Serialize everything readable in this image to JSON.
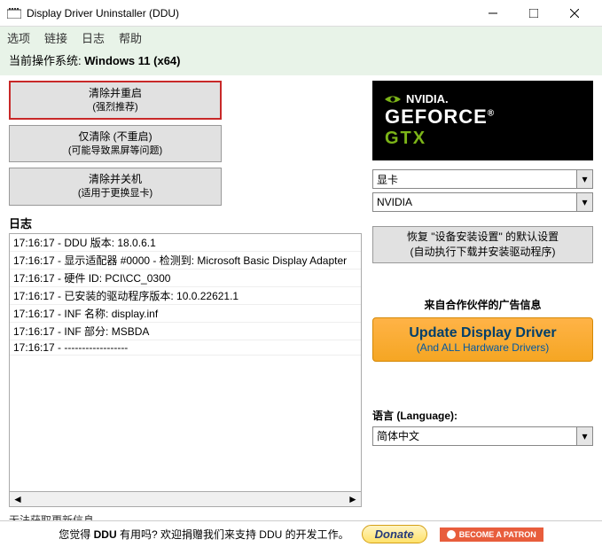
{
  "titlebar": {
    "title": "Display Driver Uninstaller (DDU)"
  },
  "menubar": {
    "items": [
      "选项",
      "链接",
      "日志",
      "帮助"
    ]
  },
  "os_row": {
    "label": "当前操作系统: ",
    "value": "Windows 11 (x64)"
  },
  "actions": {
    "clean_restart": {
      "main": "清除并重启",
      "sub": "(强烈推荐)"
    },
    "clean_only": {
      "main": "仅清除 (不重启)",
      "sub": "(可能导致黑屏等问题)"
    },
    "clean_shutdown": {
      "main": "清除并关机",
      "sub": "(适用于更换显卡)"
    }
  },
  "log": {
    "header": "日志",
    "lines": [
      "17:16:17 - DDU 版本: 18.0.6.1",
      "17:16:17 - 显示适配器 #0000 - 检测到: Microsoft Basic Display Adapter",
      "17:16:17 - 硬件 ID: PCI\\CC_0300",
      "17:16:17 - 已安装的驱动程序版本: 10.0.22621.1",
      "17:16:17 - INF 名称: display.inf",
      "17:16:17 - INF 部分: MSBDA",
      "17:16:17 - ------------------"
    ]
  },
  "status": "无法获取更新信息。",
  "gtx": {
    "nvidia": "NVIDIA.",
    "geforce": "GEFORCE",
    "gtx": "GTX"
  },
  "dropdowns": {
    "device_type": "显卡",
    "vendor": "NVIDIA"
  },
  "restore": {
    "line1": "恢复 \"设备安装设置\" 的默认设置",
    "line2": "(自动执行下载并安装驱动程序)"
  },
  "partner_label": "来自合作伙伴的广告信息",
  "update_btn": {
    "main": "Update Display Driver",
    "sub": "(And ALL Hardware Drivers)"
  },
  "lang_label": "语言 (Language):",
  "lang_value": "简体中文",
  "footer": {
    "text_pre": "您觉得 ",
    "text_bold": "DDU",
    "text_post": " 有用吗? 欢迎捐赠我们来支持 DDU 的开发工作。",
    "donate": "Donate",
    "patron": "BECOME A PATRON"
  }
}
